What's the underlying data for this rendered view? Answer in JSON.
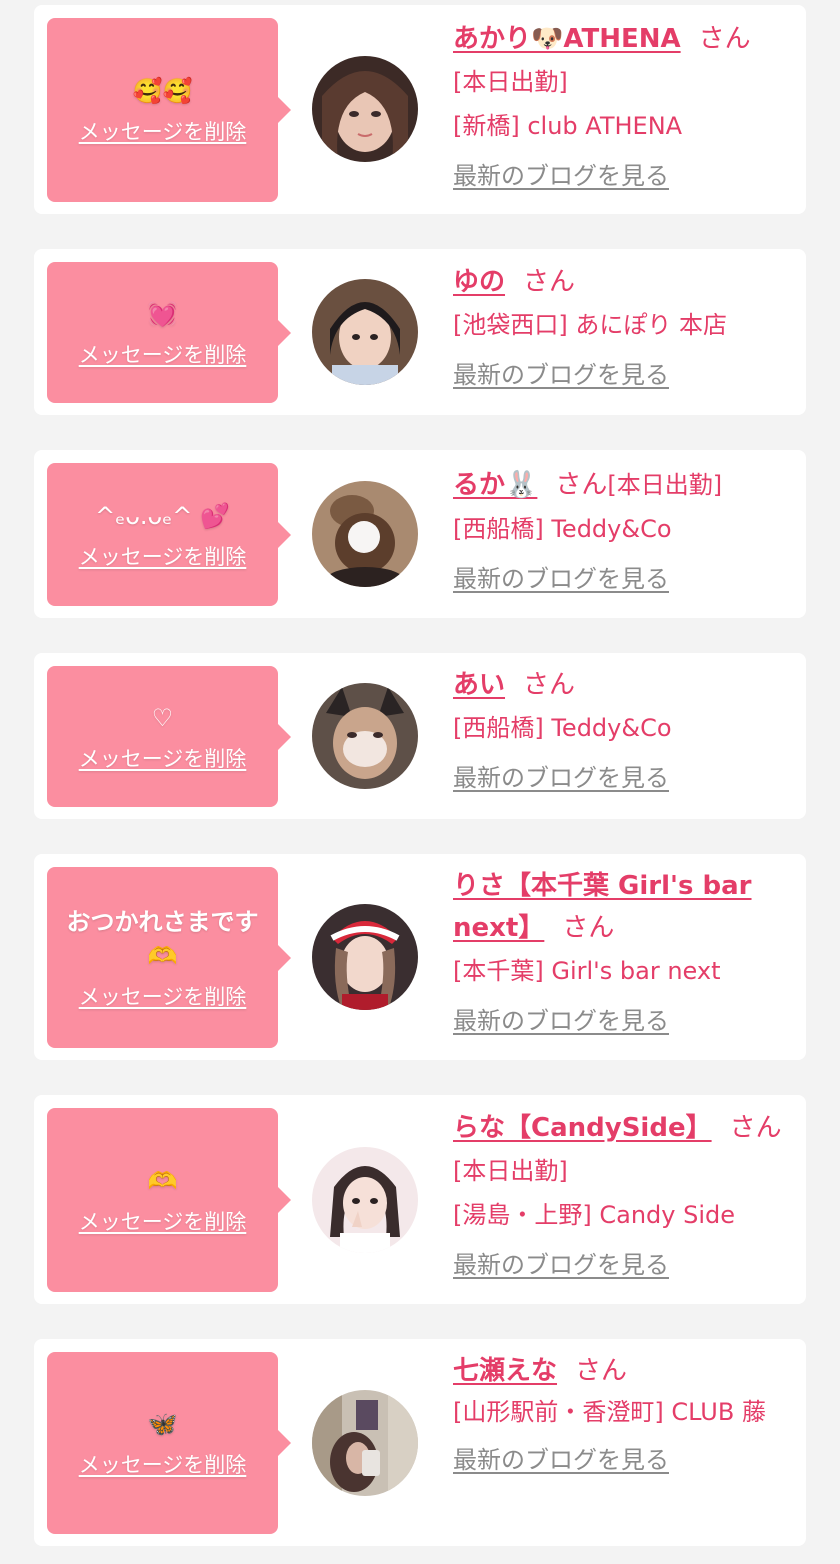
{
  "delete_label": "メッセージを削除",
  "blog_label": "最新のブログを見る",
  "san": "さん",
  "colors": {
    "bubble": "#fb8ea0",
    "accent": "#e43d68",
    "link_gray": "#8b8b8b",
    "background": "#f3f3f3"
  },
  "items": [
    {
      "message": "🥰🥰",
      "name": "あかり🐶ATHENA",
      "lines": [
        "[本日出勤]",
        "[新橋] club ATHENA"
      ]
    },
    {
      "message": "💓",
      "name": "ゆの",
      "lines": [
        "[池袋西口] あにぽり 本店"
      ]
    },
    {
      "message": "^ₑᴗ.ᴗₑ^ 💕",
      "name": "るか🐰",
      "after_san": "[本日出勤]",
      "lines": [
        "[西船橋] Teddy&Co"
      ]
    },
    {
      "message": "♡",
      "name": "あい",
      "lines": [
        "[西船橋] Teddy&Co"
      ]
    },
    {
      "message": "おつかれさまです",
      "message2": "🫶",
      "name": "りさ【本千葉 Girl's bar next】",
      "lines": [
        "[本千葉] Girl's bar next"
      ]
    },
    {
      "message": "🫶",
      "name": "らな【CandySide】",
      "lines": [
        "[本日出勤]",
        "[湯島・上野] Candy Side"
      ]
    },
    {
      "message": "🦋",
      "name": "七瀬えな",
      "lines": [
        "[山形駅前・香澄町] CLUB 藤"
      ]
    }
  ]
}
